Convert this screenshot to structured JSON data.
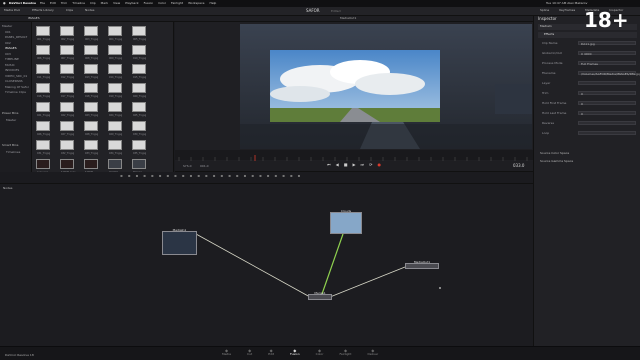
{
  "menubar": {
    "app": "DaVinci Resolve",
    "menus": [
      "File",
      "Edit",
      "Trim",
      "Timeline",
      "Clip",
      "Mark",
      "View",
      "Playback",
      "Fusion",
      "Color",
      "Fairlight",
      "Workspace",
      "Help"
    ],
    "right_text": "Tue 10:47 AM   Alex Makarov",
    "rating_badge": "18+"
  },
  "toolbar": {
    "left_buttons": [
      "Media Pool",
      "Effects Library",
      "Clips",
      "Nodes"
    ],
    "center_title": "SAFOR",
    "center_sub": "Edited",
    "right_buttons": [
      "Spline",
      "Keyframes",
      "Metadata",
      "Inspector"
    ]
  },
  "mediabar": {
    "folder_label": "IMAGES",
    "viewer_title": "MediaOut1"
  },
  "folders": {
    "items": [
      "Master",
      "001",
      "PANEL_RESULT",
      "002",
      "IMAGES",
      "003",
      "TIMELINE",
      "MUSIC",
      "INVOICES",
      "VIDEO_SRC_01",
      "CLOSEPANS",
      "Making Of Safor",
      "Timeline Clips"
    ],
    "power_bins": "Power Bins",
    "power_master": "Master",
    "smart_bins": "Smart Bins",
    "smart_item": "Timelines"
  },
  "thumbs": {
    "labels": [
      "001_T1.jpg",
      "002_T1.jpg",
      "003_T1.jpg",
      "004_T1.jpg",
      "005_T1.jpg",
      "006_T1.jpg",
      "007_T1.jpg",
      "008_T1.jpg",
      "009_T1.jpg",
      "010_T1.jpg",
      "011_T1.jpg",
      "012_T1.jpg",
      "013_T1.jpg",
      "014_T1.jpg",
      "015_T1.jpg",
      "016_T1.jpg",
      "017_T1.jpg",
      "018_T1.jpg",
      "019_T1.jpg",
      "020_T1.jpg",
      "021_T1.jpg",
      "022_T1.jpg",
      "023_T1.jpg",
      "024_T1.jpg",
      "025_T1.jpg",
      "026_T1.jpg",
      "027_T1.jpg",
      "028_T1.jpg",
      "029_T1.jpg",
      "030_T1.jpg",
      "031_T1.jpg",
      "032_T1.jpg",
      "033_T1.jpg",
      "034_T1.jpg",
      "035_T1.jpg",
      "Logo.png",
      "SAFOR Logo",
      "SAFOR",
      "Clip001",
      "Still.jpg"
    ]
  },
  "viewer": {
    "timecode_left": "SYS.0",
    "timecode_mid": "001.0",
    "timecode_right": "033.0"
  },
  "nodes": {
    "panel_title": "Nodes",
    "media_in": "MediaIn1",
    "bg_node": "Merge1",
    "cloud_node": "Clouds",
    "merge": "Merge1",
    "media_out": "MediaOut1"
  },
  "inspector": {
    "title": "Inspector",
    "tab": "MediaIn",
    "section": "Effects",
    "rows": [
      {
        "label": "Clip Name",
        "value": "DA11.jpg"
      },
      {
        "label": "Global In/Out",
        "value": "0   4000"
      },
      {
        "label": "Process Mode",
        "value": "Full Frames"
      },
      {
        "label": "Filename",
        "value": "/Volumes/SAFOR/Media/IMAGES/IMG.jpg"
      },
      {
        "label": "Layer",
        "value": ""
      },
      {
        "label": "Trim",
        "value": "0"
      },
      {
        "label": "Hold First Frame",
        "value": "0"
      },
      {
        "label": "Hold Last Frame",
        "value": "0"
      },
      {
        "label": "Reverse",
        "value": ""
      },
      {
        "label": "Loop",
        "value": ""
      }
    ],
    "source_color": "Source Color Space",
    "source_gamma": "Source Gamma Space"
  },
  "pagebar": {
    "app_version": "DaVinci Resolve 18",
    "pages": [
      "Media",
      "Cut",
      "Edit",
      "Fusion",
      "Color",
      "Fairlight",
      "Deliver"
    ],
    "active": "Fusion"
  },
  "colors": {
    "accent": "#d83a2c",
    "link_green": "#8fd14f",
    "link_white": "#d8d8c8"
  }
}
